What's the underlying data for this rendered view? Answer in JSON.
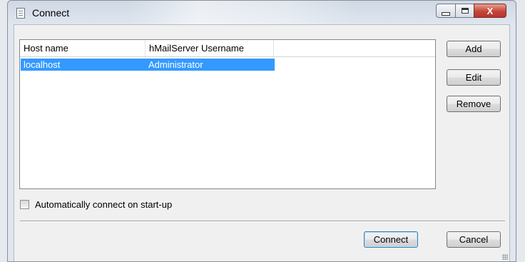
{
  "window": {
    "title": "Connect",
    "close_glyph": "X"
  },
  "icons": {
    "app": "document-icon",
    "minimize": "minimize-icon",
    "maximize": "maximize-icon",
    "close": "close-icon"
  },
  "listview": {
    "columns": [
      "Host name",
      "hMailServer Username"
    ],
    "rows": [
      {
        "host": "localhost",
        "username": "Administrator",
        "selected": true
      }
    ]
  },
  "buttons": {
    "add": "Add",
    "edit": "Edit",
    "remove": "Remove",
    "connect": "Connect",
    "cancel": "Cancel"
  },
  "options": {
    "auto_connect_label": "Automatically connect on start-up",
    "auto_connect_checked": false
  },
  "colors": {
    "selection": "#3399ff",
    "close_button": "#c4453a"
  }
}
